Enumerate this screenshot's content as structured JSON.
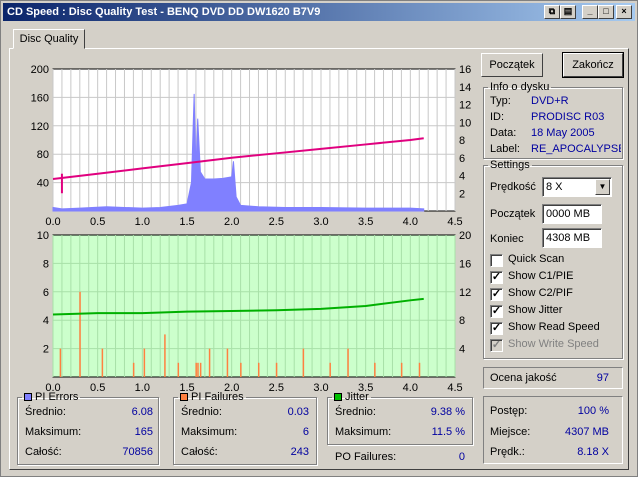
{
  "window": {
    "title": "CD Speed : Disc Quality Test - BENQ    DVD DD DW1620    B7V9"
  },
  "tab": {
    "label": "Disc Quality"
  },
  "buttons": {
    "start": "Początek",
    "stop": "Zakończ"
  },
  "disc_info": {
    "legend": "Info o dysku",
    "type_label": "Typ:",
    "type_value": "DVD+R",
    "id_label": "ID:",
    "id_value": "PRODISC R03",
    "date_label": "Data:",
    "date_value": "18 May 2005",
    "label_label": "Label:",
    "label_value": "RE_APOCALYPSE"
  },
  "settings": {
    "legend": "Settings",
    "speed_label": "Prędkość",
    "speed_value": "8 X",
    "start_label": "Początek",
    "start_value": "0000 MB",
    "end_label": "Koniec",
    "end_value": "4308 MB",
    "checks": [
      {
        "label": "Quick Scan",
        "checked": false,
        "disabled": false
      },
      {
        "label": "Show C1/PIE",
        "checked": true,
        "disabled": false
      },
      {
        "label": "Show C2/PIF",
        "checked": true,
        "disabled": false
      },
      {
        "label": "Show Jitter",
        "checked": true,
        "disabled": false
      },
      {
        "label": "Show Read Speed",
        "checked": true,
        "disabled": false
      },
      {
        "label": "Show Write Speed",
        "checked": true,
        "disabled": true
      }
    ]
  },
  "quality": {
    "label": "Ocena jakość",
    "value": "97"
  },
  "progress": {
    "progress_label": "Postęp:",
    "progress_value": "100 %",
    "position_label": "Miejsce:",
    "position_value": "4307 MB",
    "speed_label": "Prędk.:",
    "speed_value": "8.18 X"
  },
  "pi_errors": {
    "legend": "PI Errors",
    "color": "#8080ff",
    "avg_label": "Średnio:",
    "avg": "6.08",
    "max_label": "Maksimum:",
    "max": "165",
    "total_label": "Całość:",
    "total": "70856"
  },
  "pi_failures": {
    "legend": "PI Failures",
    "color": "#ff8040",
    "avg_label": "Średnio:",
    "avg": "0.03",
    "max_label": "Maksimum:",
    "max": "6",
    "total_label": "Całość:",
    "total": "243"
  },
  "jitter": {
    "legend": "Jitter",
    "color": "#00c000",
    "avg_label": "Średnio:",
    "avg": "9.38 %",
    "max_label": "Maksimum:",
    "max": "11.5 %"
  },
  "po_failures": {
    "label": "PO Failures:",
    "value": "0"
  },
  "chart_data": [
    {
      "type": "area",
      "name": "PI Errors / Read Speed",
      "xlim": [
        0,
        4.5
      ],
      "ylim_left": [
        0,
        200
      ],
      "ylim_right": [
        0,
        16
      ],
      "x_ticks": [
        "0.0",
        "0.5",
        "1.0",
        "1.5",
        "2.0",
        "2.5",
        "3.0",
        "3.5",
        "4.0",
        "4.5"
      ],
      "y_left_ticks": [
        "200",
        "160",
        "120",
        "80",
        "40"
      ],
      "y_right_ticks": [
        "16",
        "14",
        "12",
        "10",
        "8",
        "6",
        "4",
        "2"
      ],
      "grid": true,
      "series": [
        {
          "color": "#8080ff",
          "x": [
            0.0,
            0.1,
            0.3,
            0.6,
            0.8,
            1.0,
            1.2,
            1.4,
            1.5,
            1.55,
            1.58,
            1.6,
            1.62,
            1.65,
            1.7,
            1.8,
            1.9,
            2.0,
            2.02,
            2.05,
            2.1,
            2.3,
            2.6,
            3.0,
            3.5,
            4.0,
            4.15
          ],
          "values": [
            5,
            3,
            4,
            6,
            5,
            4,
            5,
            8,
            10,
            40,
            165,
            60,
            130,
            55,
            45,
            45,
            46,
            48,
            70,
            20,
            8,
            6,
            5,
            5,
            4,
            4,
            3
          ]
        },
        {
          "color": "#e0007f",
          "x": [
            0.0,
            0.5,
            1.0,
            1.5,
            2.0,
            2.5,
            3.0,
            3.5,
            4.0,
            4.15
          ],
          "values": [
            3.6,
            4.2,
            4.8,
            5.4,
            6.0,
            6.5,
            7.0,
            7.5,
            8.0,
            8.2
          ]
        }
      ]
    },
    {
      "type": "bar",
      "name": "PI Failures / Jitter",
      "xlim": [
        0,
        4.5
      ],
      "ylim_left": [
        0,
        10
      ],
      "ylim_right": [
        0,
        20
      ],
      "x_ticks": [
        "0.0",
        "0.5",
        "1.0",
        "1.5",
        "2.0",
        "2.5",
        "3.0",
        "3.5",
        "4.0",
        "4.5"
      ],
      "y_left_ticks": [
        "10",
        "8",
        "6",
        "4",
        "2"
      ],
      "y_right_ticks": [
        "20",
        "16",
        "12",
        "8",
        "4"
      ],
      "grid": true,
      "series": [
        {
          "color": "#ff8040",
          "x": [
            0.08,
            0.3,
            0.55,
            0.9,
            1.02,
            1.25,
            1.4,
            1.6,
            1.62,
            1.65,
            1.75,
            1.95,
            2.1,
            2.3,
            2.5,
            2.8,
            3.1,
            3.3,
            3.6,
            3.9,
            4.1
          ],
          "values": [
            2,
            6,
            2,
            1,
            2,
            3,
            1,
            1,
            1,
            1,
            2,
            2,
            1,
            1,
            1,
            2,
            1,
            2,
            1,
            1,
            1
          ]
        },
        {
          "color": "#00b000",
          "x": [
            0.0,
            0.5,
            1.0,
            1.5,
            2.0,
            2.5,
            3.0,
            3.5,
            4.0,
            4.15
          ],
          "values": [
            8.8,
            9.0,
            9.0,
            9.2,
            9.3,
            9.4,
            9.6,
            10.0,
            10.8,
            11.0
          ]
        }
      ]
    }
  ]
}
